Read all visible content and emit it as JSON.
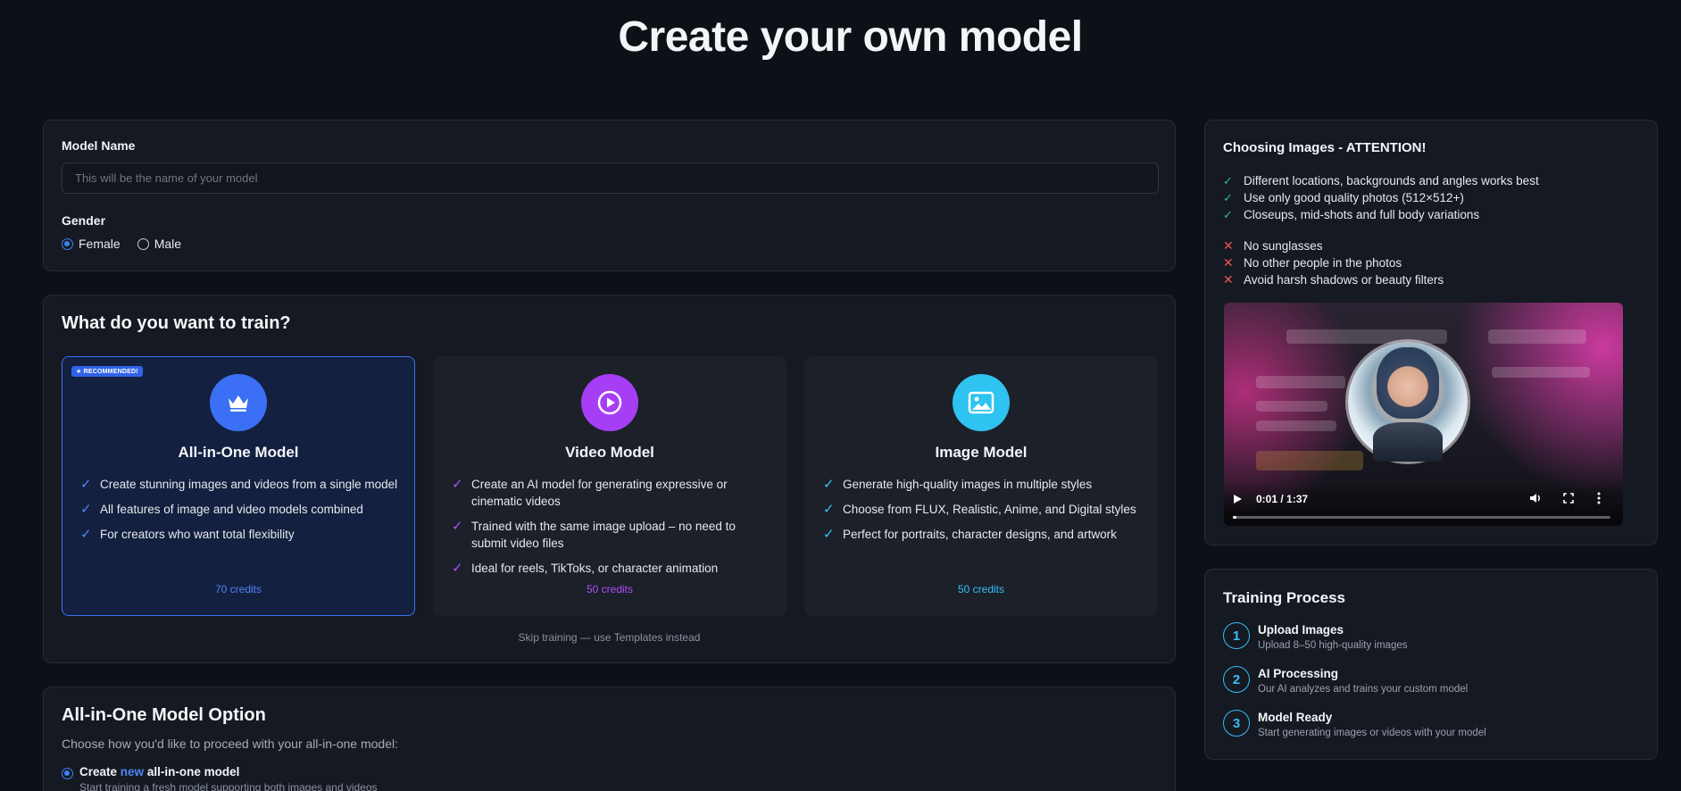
{
  "page": {
    "title": "Create your own model"
  },
  "model_name": {
    "label": "Model Name",
    "placeholder": "This will be the name of your model",
    "value": ""
  },
  "gender": {
    "label": "Gender",
    "options": [
      {
        "label": "Female",
        "checked": true
      },
      {
        "label": "Male",
        "checked": false
      }
    ]
  },
  "train": {
    "title": "What do you want to train?",
    "options": [
      {
        "badge": "RECOMMENDED!",
        "title": "All-in-One Model",
        "icon": "crown-icon",
        "icon_color": "#3b6ff5",
        "check_color": "#4f86f7",
        "features": [
          "Create stunning images and videos from a single model",
          "All features of image and video models combined",
          "For creators who want total flexibility"
        ],
        "credits": "70 credits",
        "credits_color": "#4f86f7",
        "selected": true
      },
      {
        "title": "Video Model",
        "icon": "play-icon",
        "icon_color": "#a63ef5",
        "check_color": "#b14ef7",
        "features": [
          "Create an AI model for generating expressive or cinematic videos",
          "Trained with the same image upload – no need to submit video files",
          "Ideal for reels, TikToks, or character animation"
        ],
        "credits": "50 credits",
        "credits_color": "#b14ef7",
        "selected": false
      },
      {
        "title": "Image Model",
        "icon": "image-icon",
        "icon_color": "#2ec3f0",
        "check_color": "#38bdf8",
        "features": [
          "Generate high-quality images in multiple styles",
          "Choose from FLUX, Realistic, Anime, and Digital styles",
          "Perfect for portraits, character designs, and artwork"
        ],
        "credits": "50 credits",
        "credits_color": "#38bdf8",
        "selected": false
      }
    ],
    "skip_link": "Skip training — use Templates instead"
  },
  "aio_option": {
    "title": "All-in-One Model Option",
    "subtitle": "Choose how you'd like to proceed with your all-in-one model:",
    "choice": {
      "prefix": "Create",
      "highlight": "new",
      "suffix": "all-in-one model",
      "description": "Start training a fresh model supporting both images and videos"
    }
  },
  "attention": {
    "title": "Choosing Images - ATTENTION!",
    "do": [
      "Different locations, backgrounds and angles works best",
      "Use only good quality photos (512×512+)",
      "Closeups, mid-shots and full body variations"
    ],
    "dont": [
      "No sunglasses",
      "No other people in the photos",
      "Avoid harsh shadows or beauty filters"
    ],
    "video": {
      "time": "0:01 / 1:37",
      "progress": 0.01
    }
  },
  "process": {
    "title": "Training Process",
    "steps": [
      {
        "num": "1",
        "title": "Upload Images",
        "desc": "Upload 8–50 high-quality images"
      },
      {
        "num": "2",
        "title": "AI Processing",
        "desc": "Our AI analyzes and trains your custom model"
      },
      {
        "num": "3",
        "title": "Model Ready",
        "desc": "Start generating images or videos with your model"
      }
    ]
  }
}
